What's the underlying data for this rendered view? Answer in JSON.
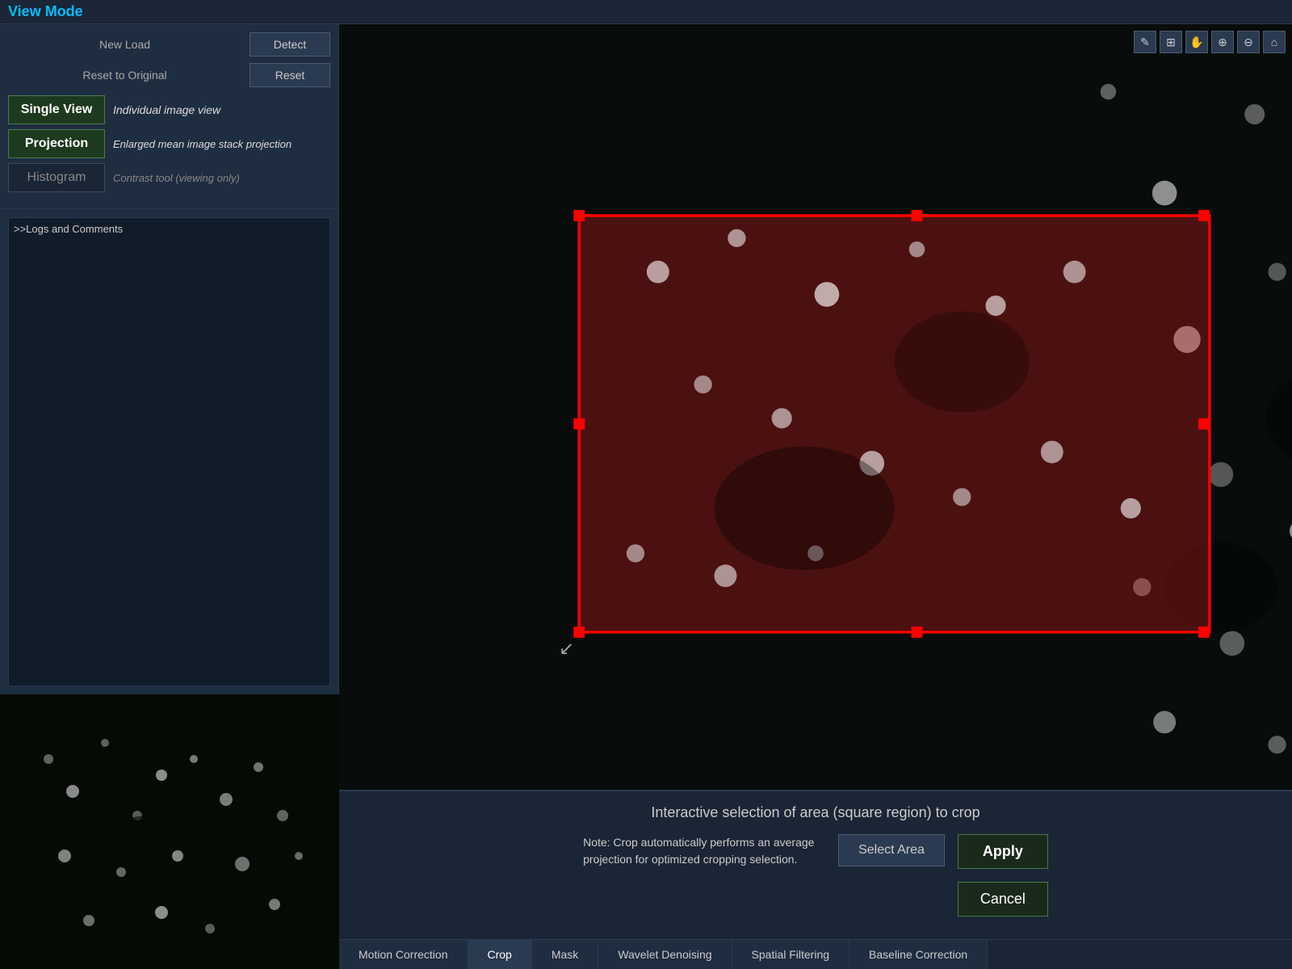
{
  "title": "View Mode",
  "left_panel": {
    "new_load": "New Load",
    "detect": "Detect",
    "reset_to_original": "Reset to Original",
    "reset": "Reset",
    "single_view_label": "Single View",
    "single_view_desc": "Individual image view",
    "projection_label": "Projection",
    "projection_desc": "Enlarged mean image stack projection",
    "histogram_label": "Histogram",
    "contrast_tool_desc": "Contrast tool (viewing only)",
    "logs_label": ">>Logs and Comments"
  },
  "crop_panel": {
    "title": "Interactive selection of area (square region) to crop",
    "select_area": "Select Area",
    "apply": "Apply",
    "cancel": "Cancel",
    "note": "Note: Crop automatically performs an average projection for optimized cropping selection."
  },
  "tabs": [
    {
      "label": "Motion Correction",
      "active": false
    },
    {
      "label": "Crop",
      "active": true
    },
    {
      "label": "Mask",
      "active": false
    },
    {
      "label": "Wavelet Denoising",
      "active": false
    },
    {
      "label": "Spatial Filtering",
      "active": false
    },
    {
      "label": "Baseline Correction",
      "active": false
    }
  ],
  "toolbar": {
    "icons": [
      "✎",
      "⊞",
      "✋",
      "⊕",
      "⊖",
      "⌂"
    ]
  },
  "colors": {
    "accent_blue": "#00bfff",
    "panel_bg": "#1e2d40",
    "dark_bg": "#0a0a0a",
    "crop_rect": "#ff0000"
  }
}
